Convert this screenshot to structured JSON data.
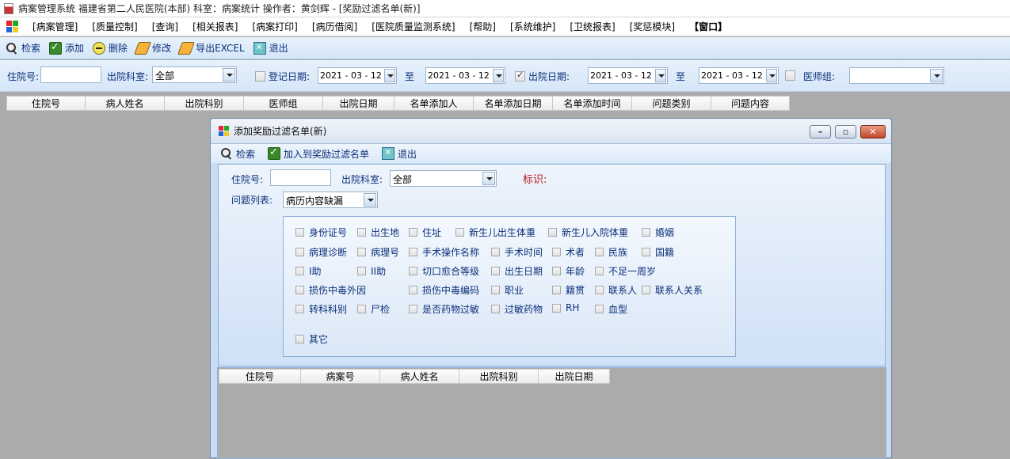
{
  "window": {
    "title": "病案管理系统  福建省第二人民医院(本部)  科室：病案统计 操作者：黄剑辉 - [奖励过滤名单(新)]"
  },
  "menu": [
    "[病案管理]",
    "[质量控制]",
    "[查询]",
    "[相关报表]",
    "[病案打印]",
    "[病历借阅]",
    "[医院质量监测系统]",
    "[帮助]",
    "[系统维护]",
    "[卫统报表]",
    "[奖惩模块]",
    "【窗口】"
  ],
  "toolbar": {
    "search": "检索",
    "add": "添加",
    "delete": "删除",
    "edit": "修改",
    "export": "导出EXCEL",
    "exit": "退出"
  },
  "filters": {
    "admission_no_label": "住院号:",
    "admission_no_value": "",
    "dept_label": "出院科室:",
    "dept_value": "全部",
    "reg_date_label": "登记日期:",
    "reg_date_from": "2021 - 03 - 12",
    "to1": "至",
    "reg_date_to": "2021 - 03 - 12",
    "discharge_date_label": "出院日期:",
    "discharge_date_from": "2021 - 03 - 12",
    "to2": "至",
    "discharge_date_to": "2021 - 03 - 12",
    "doctor_group_label": "医师组:",
    "doctor_group_value": ""
  },
  "main_grid": {
    "columns": [
      "住院号",
      "病人姓名",
      "出院科别",
      "医师组",
      "出院日期",
      "名单添加人",
      "名单添加日期",
      "名单添加时间",
      "问题类别",
      "问题内容"
    ]
  },
  "dialog": {
    "title": "添加奖励过滤名单(新)",
    "toolbar": {
      "search": "检索",
      "add_to_list": "加入到奖励过滤名单",
      "exit": "退出"
    },
    "admission_no_label": "住院号:",
    "admission_no_value": "",
    "dept_label": "出院科室:",
    "dept_value": "全部",
    "ident_label": "标识:",
    "issue_list_label": "问题列表:",
    "issue_list_value": "病历内容缺漏",
    "options": [
      "身份证号",
      "出生地",
      "住址",
      "新生儿出生体重",
      "新生儿入院体重",
      "婚姻",
      "病理诊断",
      "病理号",
      "手术操作名称",
      "手术时间",
      "术者",
      "民族",
      "国籍",
      "I助",
      "II助",
      "切口愈合等级",
      "出生日期",
      "年龄",
      "不足一周岁",
      "损伤中毒外因",
      "损伤中毒编码",
      "职业",
      "籍贯",
      "联系人",
      "联系人关系",
      "转科科别",
      "尸检",
      "是否药物过敏",
      "过敏药物",
      "RH",
      "血型",
      "其它"
    ],
    "grid_columns": [
      "住院号",
      "病案号",
      "病人姓名",
      "出院科别",
      "出院日期"
    ]
  },
  "colors": {
    "accent": "#0b2f79",
    "ident_red": "#c0141c",
    "close_button": "#c0452a"
  }
}
